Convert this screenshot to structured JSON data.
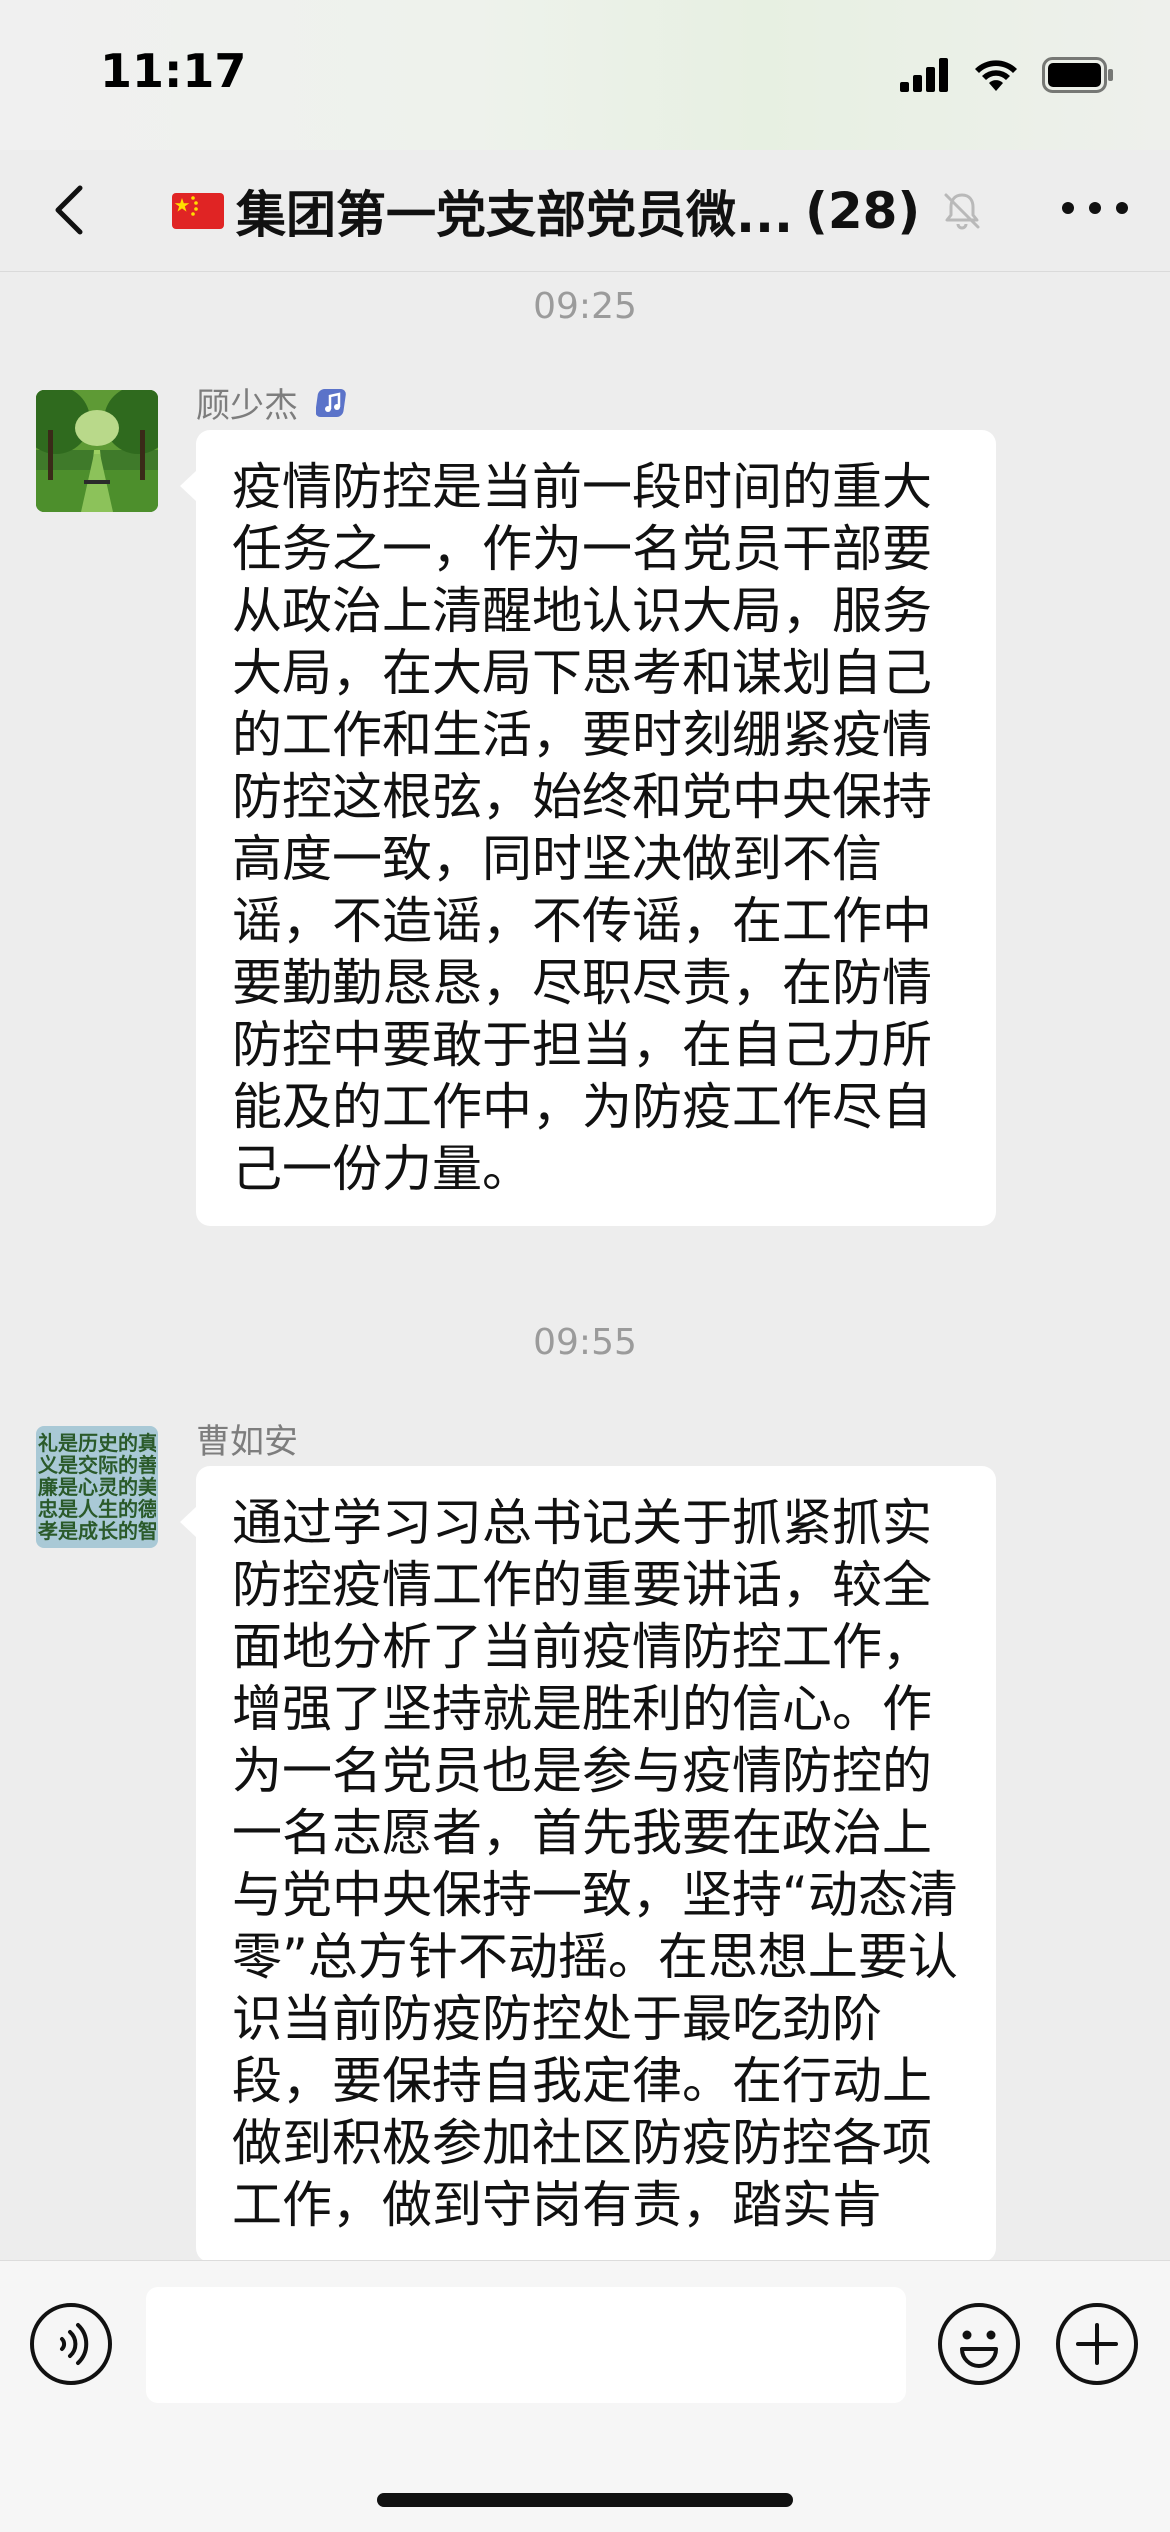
{
  "status_bar": {
    "time": "11:17"
  },
  "header": {
    "flag_emoji_icon": "china-flag-icon",
    "title": "集团第一党支部党员微...",
    "member_count": "(28)",
    "muted": true
  },
  "messages": [
    {
      "time": "09:25",
      "sender": "顾少杰",
      "text": "疫情防控是当前一段时间的重大任务之一，作为一名党员干部要从政治上清醒地认识大局，服务大局，在大局下思考和谋划自己的工作和生活，要时刻绷紧疫情防控这根弦，始终和党中央保持高度一致，同时坚决做到不信谣，不造谣，不传谣，在工作中要勤勤恳恳，尽职尽责，在防情防控中要敢于担当，在自己力所能及的工作中，为防疫工作尽自己一份力量。"
    },
    {
      "time": "09:55",
      "sender": "曹如安",
      "avatar_text": [
        "礼是历史的真",
        "义是交际的善",
        "廉是心灵的美",
        "忠是人生的德",
        "孝是成长的智"
      ],
      "text": "通过学习习总书记关于抓紧抓实防控疫情工作的重要讲话，较全面地分析了当前疫情防控工作，增强了坚持就是胜利的信心。作为一名党员也是参与疫情防控的一名志愿者，首先我要在政治上与党中央保持一致，坚持“动态清零”总方针不动摇。在思想上要认识当前防疫防控处于最吃劲阶段，要保持自我定律。在行动上做到积极参加社区防疫防控各项工作，做到守岗有责，踏实肯"
    }
  ],
  "input_bar": {
    "placeholder": ""
  }
}
